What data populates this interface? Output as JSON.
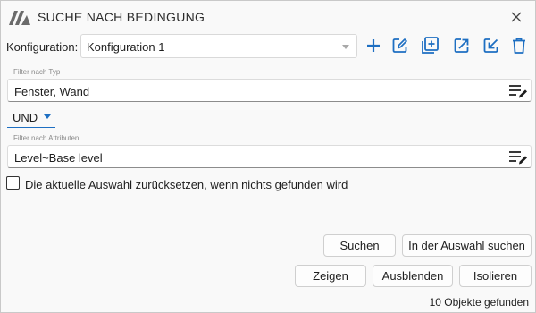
{
  "window": {
    "title": "SUCHE NACH BEDINGUNG",
    "accent_color": "#1e6fc2"
  },
  "configuration": {
    "label": "Konfiguration:",
    "selected": "Konfiguration 1"
  },
  "toolbar": {
    "icons": [
      "plus-icon",
      "edit-icon",
      "duplicate-icon",
      "export-icon",
      "import-icon",
      "trash-icon"
    ]
  },
  "type_filter": {
    "caption": "Filter nach Typ",
    "value": "Fenster, Wand"
  },
  "logic_operator": {
    "selected": "UND"
  },
  "attribute_filter": {
    "caption": "Filter nach Attributen",
    "value": "Level~Base level"
  },
  "reset_option": {
    "label": "Die aktuelle Auswahl zurücksetzen, wenn nichts gefunden wird",
    "checked": false
  },
  "buttons": {
    "search": "Suchen",
    "search_in_selection": "In der Auswahl suchen",
    "show": "Zeigen",
    "hide": "Ausblenden",
    "isolate": "Isolieren"
  },
  "status": {
    "text": "10 Objekte gefunden"
  }
}
